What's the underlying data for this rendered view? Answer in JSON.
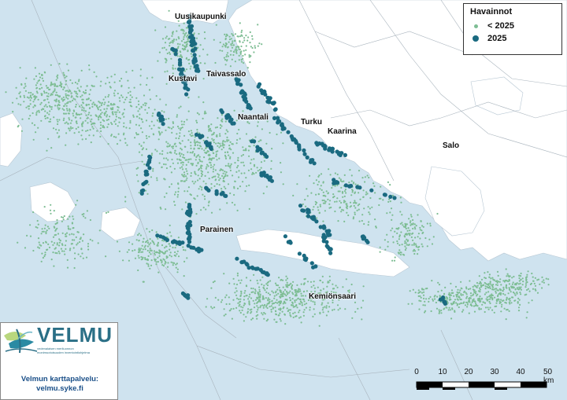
{
  "legend": {
    "title": "Havainnot",
    "items": [
      {
        "label": "< 2025",
        "color": "#7dbd93"
      },
      {
        "label": "2025",
        "color": "#1a6a80"
      }
    ]
  },
  "places": [
    {
      "name": "Uusikaupunki"
    },
    {
      "name": "Kustavi"
    },
    {
      "name": "Taivassalo"
    },
    {
      "name": "Naantali"
    },
    {
      "name": "Turku"
    },
    {
      "name": "Kaarina"
    },
    {
      "name": "Salo"
    },
    {
      "name": "Parainen"
    },
    {
      "name": "Kemiönsaari"
    }
  ],
  "logo": {
    "name": "VELMU",
    "subtitle_lines": [
      "vedenalaisen meriluonnon",
      "monimuotoisuuden inventointiohjelma"
    ]
  },
  "service": {
    "line1": "Velmun karttapalvelu:",
    "line2": "velmu.syke.fi"
  },
  "scale": {
    "ticks": [
      "0",
      "10",
      "20",
      "30",
      "40",
      "50 km"
    ]
  },
  "colors": {
    "sea": "#cfe3ef",
    "land": "#ffffff",
    "old_obs": "#7dbd93",
    "new_obs": "#1a6a80"
  }
}
